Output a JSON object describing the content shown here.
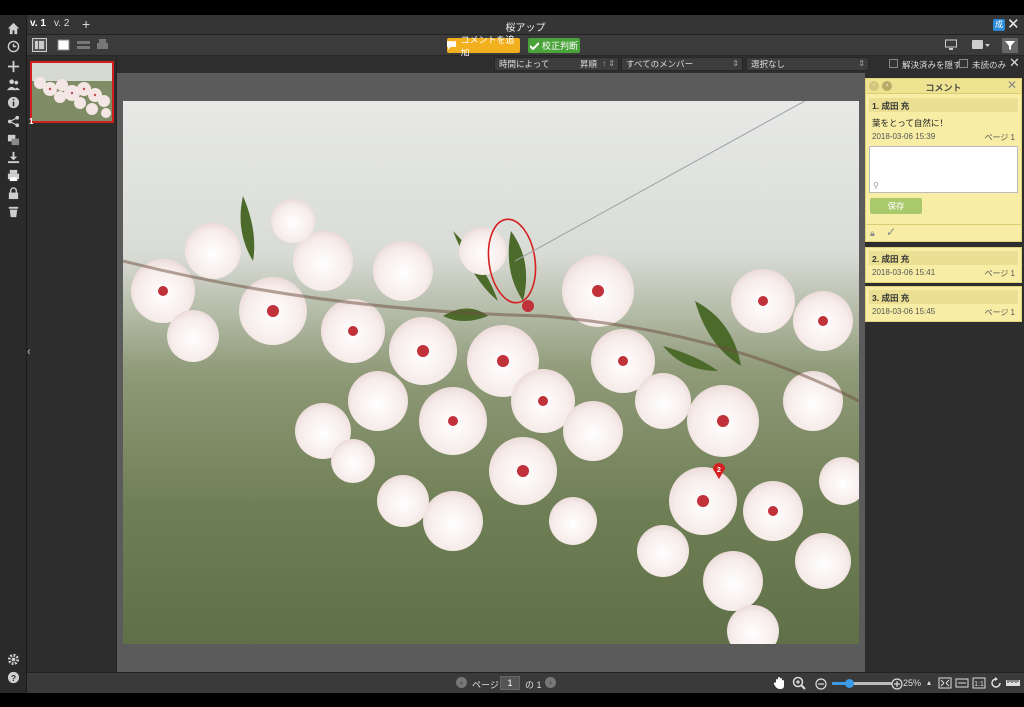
{
  "app": {
    "title": "桜アップ",
    "versions": [
      "v. 1",
      "v. 2"
    ],
    "add_version": "+",
    "user_badge": "成"
  },
  "toolbar": {
    "add_comment": "コメントを追加",
    "proof_decision": "校正判断"
  },
  "filters": {
    "sort_by": "時間によって",
    "order": "昇順",
    "members": "すべてのメンバー",
    "selection": "選択なし",
    "hide_resolved": "解決済みを隠す",
    "unread_only": "未読のみ"
  },
  "thumbnails": [
    {
      "number": "1",
      "selected": true
    }
  ],
  "comments_panel": {
    "title": "コメント",
    "active": {
      "author": "1. 成田 充",
      "text": "葉をとって自然に！",
      "date": "2018-03-06 15:39",
      "page": "ページ 1",
      "reply_placeholder": "",
      "save_label": "保存"
    },
    "others": [
      {
        "author": "2. 成田 充",
        "date": "2018-03-06 15:41",
        "page": "ページ 1"
      },
      {
        "author": "3. 成田 充",
        "date": "2018-03-06 15:45",
        "page": "ページ 1"
      }
    ]
  },
  "annotations": [
    {
      "number": "1",
      "shape": "ellipse",
      "color": "#d42020"
    },
    {
      "number": "2",
      "shape": "pin",
      "color": "#d42020"
    }
  ],
  "status": {
    "page_label": "ページ",
    "page_value": "1",
    "page_total": "の 1",
    "zoom": "25%",
    "zoom_fraction": 0.28
  },
  "colors": {
    "accent_orange": "#f2b01e",
    "accent_green": "#4aa33a",
    "comment_bg": "#f7eda5",
    "annotation_red": "#d42020",
    "zoom_blue": "#3c9be8"
  }
}
